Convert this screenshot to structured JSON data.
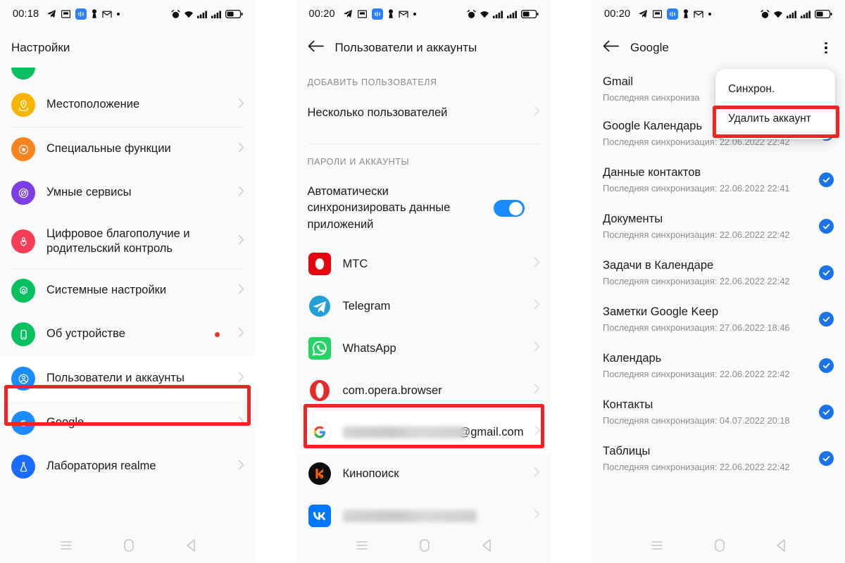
{
  "meta": {
    "accent_blue": "#1a8cff",
    "highlight_red": "#ef2424",
    "bg": "#fafafa"
  },
  "panel1": {
    "statusbar": {
      "clock": "00:18",
      "left_icons": [
        "telegram-icon",
        "app-icon",
        "bluetooth-badge-icon",
        "keyhole-icon",
        "gmail-icon",
        "dot-icon"
      ],
      "right_icons": [
        "alarm-icon",
        "wifi-icon",
        "signal-sim1-icon",
        "signal-sim2-icon",
        "battery-icon"
      ]
    },
    "title": "Настройки",
    "items": [
      {
        "label": "Местоположение",
        "icon": "location-pin-icon",
        "color": "#f7b500",
        "badge": false
      },
      {
        "label": "Специальные функции",
        "icon": "star-accessibility-icon",
        "color": "#f7841f",
        "badge": false
      },
      {
        "label": "Умные сервисы",
        "icon": "smart-services-icon",
        "color": "#7b3fe4",
        "badge": false
      },
      {
        "label": "Цифровое благополучие и родительский контроль",
        "icon": "heart-wellbeing-icon",
        "color": "#f63d58",
        "badge": false
      },
      {
        "label": "Системные настройки",
        "icon": "gear-system-icon",
        "color": "#07c160",
        "badge": false
      },
      {
        "label": "Об устройстве",
        "icon": "phone-device-icon",
        "color": "#07c160",
        "badge": true
      },
      {
        "label": "Пользователи и аккаунты",
        "icon": "user-account-icon",
        "color": "#1a8cff",
        "badge": false,
        "highlighted": true
      },
      {
        "label": "Google",
        "icon": "google-g-icon",
        "color": "#1a8cff",
        "badge": false
      },
      {
        "label": "Лаборатория realme",
        "icon": "flask-lab-icon",
        "color": "#1a6bff",
        "badge": false
      }
    ],
    "navbar": [
      "menu-icon",
      "home-icon",
      "back-icon"
    ]
  },
  "panel2": {
    "statusbar": {
      "clock": "00:20",
      "left_icons": [
        "telegram-icon",
        "app-icon",
        "bluetooth-badge-icon",
        "keyhole-icon",
        "gmail-icon",
        "dot-icon"
      ],
      "right_icons": [
        "alarm-icon",
        "wifi-icon",
        "signal-sim1-icon",
        "signal-sim2-icon",
        "battery-icon"
      ]
    },
    "appbar": {
      "back": "back-arrow-icon",
      "title": "Пользователи и аккаунты"
    },
    "section_add_user": "ДОБАВИТЬ ПОЛЬЗОВАТЕЛЯ",
    "multi_user": "Несколько пользователей",
    "section_passwords": "ПАРОЛИ И АККАУНТЫ",
    "autosync": {
      "label": "Автоматически синхронизировать данные приложений",
      "enabled": true
    },
    "accounts": [
      {
        "label": "МТС",
        "icon": "mts-icon",
        "blurred": false
      },
      {
        "label": "Telegram",
        "icon": "telegram-app-icon",
        "blurred": false
      },
      {
        "label": "WhatsApp",
        "icon": "whatsapp-icon",
        "blurred": false
      },
      {
        "label": "com.opera.browser",
        "icon": "opera-icon",
        "blurred": false
      },
      {
        "label": "@gmail.com",
        "icon": "google-g-icon",
        "blurred": true,
        "highlighted": true
      },
      {
        "label": "Кинопоиск",
        "icon": "kinopoisk-icon",
        "blurred": false
      },
      {
        "label": "",
        "icon": "vk-icon",
        "blurred": true
      }
    ],
    "navbar": [
      "menu-icon",
      "home-icon",
      "back-icon"
    ]
  },
  "panel3": {
    "statusbar": {
      "clock": "00:20",
      "left_icons": [
        "telegram-icon",
        "app-icon",
        "bluetooth-badge-icon",
        "keyhole-icon",
        "gmail-icon",
        "dot-icon"
      ],
      "right_icons": [
        "alarm-icon",
        "wifi-icon",
        "signal-sim1-icon",
        "signal-sim2-icon",
        "battery-icon"
      ]
    },
    "appbar": {
      "back": "back-arrow-icon",
      "title": "Google",
      "overflow": "overflow-menu-icon"
    },
    "popup": {
      "items": [
        {
          "label": "Синхрон.",
          "highlighted": false
        },
        {
          "label": "Удалить аккаунт",
          "highlighted": true
        }
      ]
    },
    "sync_items": [
      {
        "title": "Gmail",
        "sub": "Последняя синхрониза",
        "checked": false
      },
      {
        "title": "Google Календарь",
        "sub": "Последняя синхронизация: 22.06.2022 22:42",
        "checked": true
      },
      {
        "title": "Данные контактов",
        "sub": "Последняя синхронизация: 22.06.2022 22:41",
        "checked": true
      },
      {
        "title": "Документы",
        "sub": "Последняя синхронизация: 22.06.2022 22:42",
        "checked": true
      },
      {
        "title": "Задачи в Календаре",
        "sub": "Последняя синхронизация: 22.06.2022 22:42",
        "checked": true
      },
      {
        "title": "Заметки Google Keep",
        "sub": "Последняя синхронизация: 27.06.2022 18:46",
        "checked": true
      },
      {
        "title": "Календарь",
        "sub": "Последняя синхронизация: 22.06.2022 22:42",
        "checked": true
      },
      {
        "title": "Контакты",
        "sub": "Последняя синхронизация: 04.07.2022 20:18",
        "checked": true
      },
      {
        "title": "Таблицы",
        "sub": "Последняя синхронизация: 22.06.2022 22:42",
        "checked": true
      }
    ],
    "navbar": [
      "menu-icon",
      "home-icon",
      "back-icon"
    ]
  }
}
